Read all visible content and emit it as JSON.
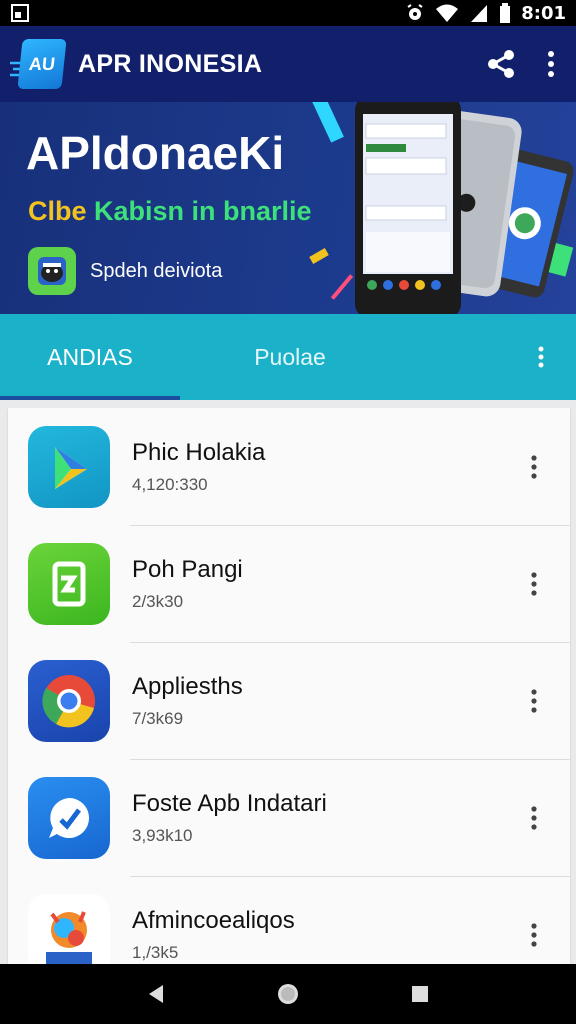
{
  "status_bar": {
    "time": "8:01",
    "icons": [
      "notification-icon",
      "alarm-icon",
      "wifi-icon",
      "signal-icon",
      "battery-icon"
    ]
  },
  "app_bar": {
    "logo_text": "AU",
    "title": "APR INONESIA",
    "actions": [
      "share-icon",
      "more-vert-icon"
    ]
  },
  "hero": {
    "title": "AΡldonaeKi",
    "subtitle_part1": "Clbe",
    "subtitle_part2": "Kabisn in bnarlie",
    "badge_text": "Spdeh deiviota"
  },
  "tabs": [
    {
      "label": "ANDIAS",
      "selected": true
    },
    {
      "label": "Puolae",
      "selected": false
    }
  ],
  "apps": [
    {
      "name": "Phic Holakia",
      "meta": "4,120:330",
      "icon": "play-store-icon"
    },
    {
      "name": "Poh Pangi",
      "meta": "2/3k30",
      "icon": "green-app-icon"
    },
    {
      "name": "Appliesths",
      "meta": "7/3k69",
      "icon": "chrome-icon"
    },
    {
      "name": "Foste Apb Indatari",
      "meta": "3,93k10",
      "icon": "message-icon"
    },
    {
      "name": "Afmincoealiqos",
      "meta": "1,/3k5",
      "icon": "colorful-app-icon"
    }
  ],
  "nav": [
    "back-icon",
    "home-icon",
    "recents-icon"
  ],
  "colors": {
    "app_bar": "#12206b",
    "hero": "#1c3a8c",
    "tabs": "#1bb1c9",
    "tab_indicator": "#1a4fa0"
  }
}
